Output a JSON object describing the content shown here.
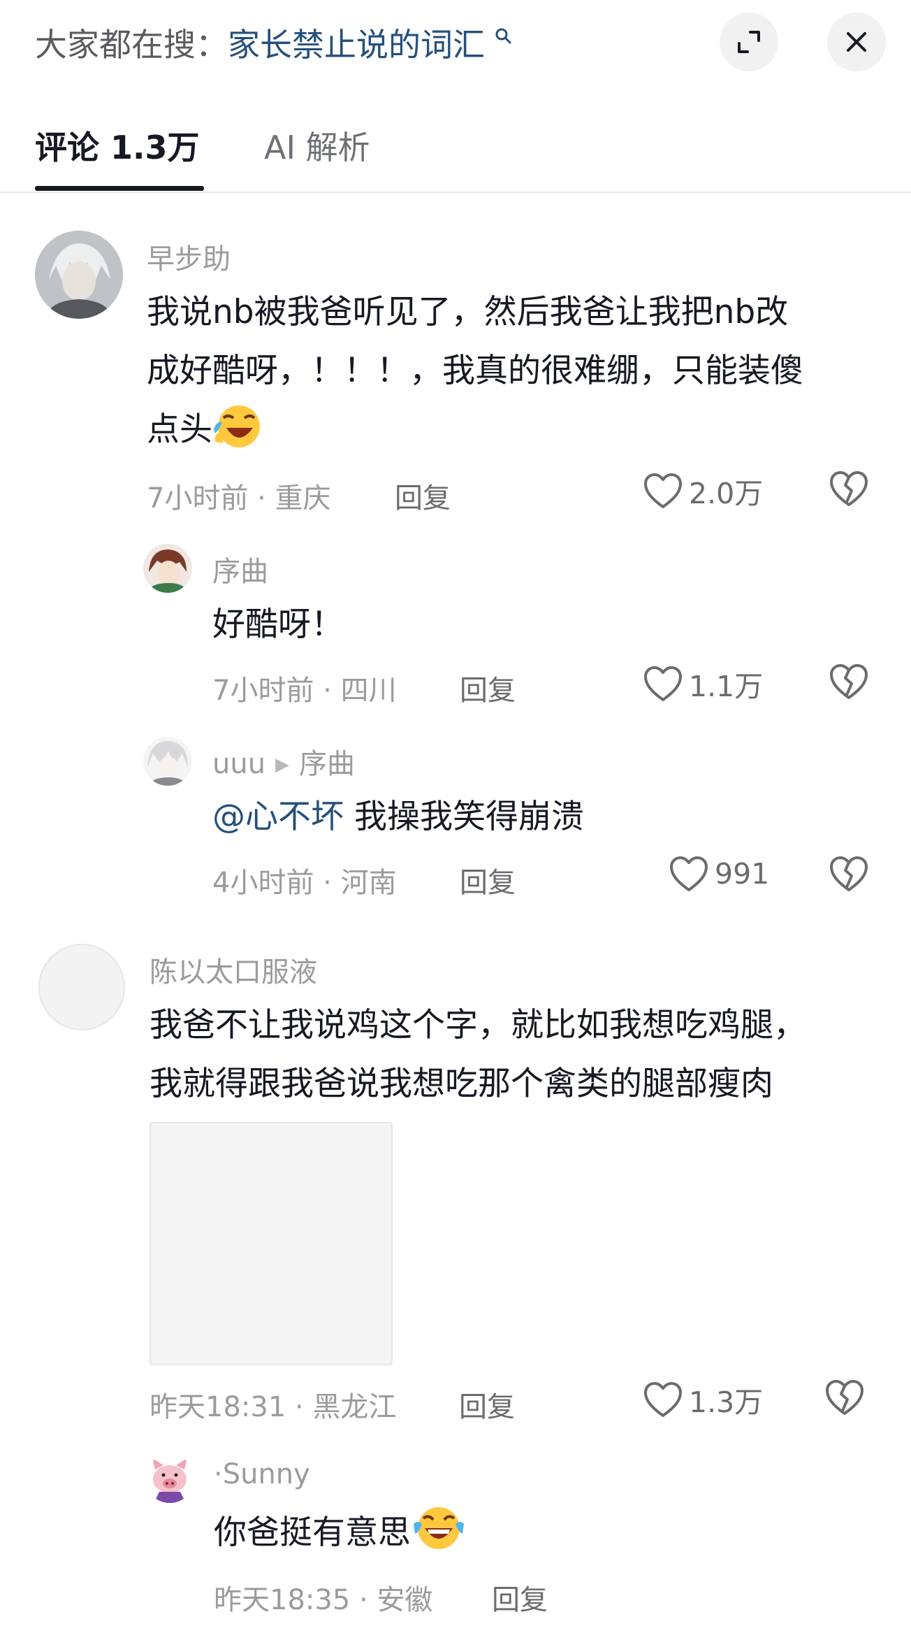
{
  "header": {
    "search_prefix": "大家都在搜：",
    "search_keyword": "家长禁止说的词汇",
    "search_icon": "search-icon",
    "expand_icon": "expand-icon",
    "close_icon": "close-icon"
  },
  "tabs": [
    {
      "label": "评论 1.3万",
      "active": true
    },
    {
      "label": "AI 解析",
      "active": false
    }
  ],
  "comments": [
    {
      "user": "早步助",
      "text_lines": [
        "我说nb被我爸听见了，然后我爸让我把nb改",
        "成好酷呀，！！！，我真的很难绷，只能装傻",
        "点头"
      ],
      "emoji": "laughing-crying-emoji",
      "time": "7小时前",
      "location": "重庆",
      "reply_label": "回复",
      "likes": "2.0万",
      "replies": [
        {
          "user": "序曲",
          "text": "好酷呀！",
          "time": "7小时前",
          "location": "四川",
          "reply_label": "回复",
          "likes": "1.1万"
        },
        {
          "user": "uuu",
          "reply_to": "序曲",
          "mention": "@心不坏",
          "text": "我操我笑得崩溃",
          "time": "4小时前",
          "location": "河南",
          "reply_label": "回复",
          "likes": "991"
        }
      ]
    },
    {
      "user": "陈以太口服液",
      "text_lines": [
        "我爸不让我说鸡这个字，就比如我想吃鸡腿，",
        "我就得跟我爸说我想吃那个禽类的腿部瘦肉"
      ],
      "time": "昨天18:31",
      "location": "黑龙江",
      "reply_label": "回复",
      "likes": "1.3万",
      "replies": [
        {
          "user": "·Sunny",
          "text": "你爸挺有意思",
          "emoji": "tears-of-joy-emoji",
          "time": "昨天18:35",
          "location": "安徽",
          "reply_label": "回复"
        }
      ]
    }
  ],
  "meta_separator": " · ",
  "colors": {
    "text": "#161823",
    "secondary": "#9a9ba0",
    "link": "#25507a",
    "chip_bg": "#f1f1f2"
  }
}
